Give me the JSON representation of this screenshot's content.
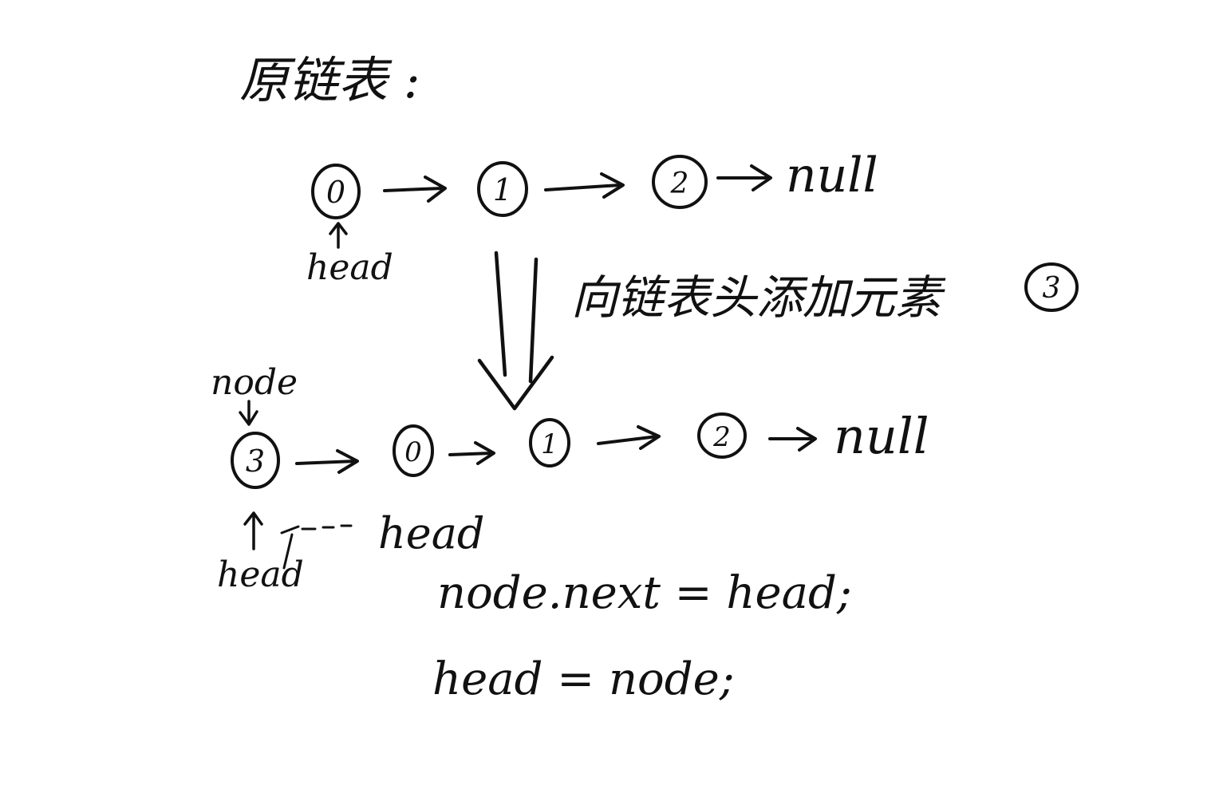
{
  "title": "原链表 :",
  "original_list": {
    "nodes": [
      "0",
      "1",
      "2"
    ],
    "tail": "null",
    "head_label": "head"
  },
  "operation_label": "向链表头添加元素",
  "operation_node": "3",
  "new_list": {
    "nodes": [
      "3",
      "0",
      "1",
      "2"
    ],
    "tail": "null",
    "node_label": "node",
    "head_label_new": "head",
    "head_label_old": "head"
  },
  "code": [
    "node.next = head;",
    "head = node;"
  ]
}
